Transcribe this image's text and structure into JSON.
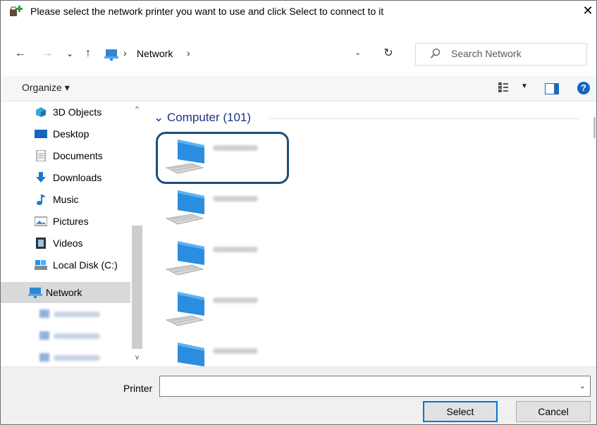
{
  "window": {
    "title": "Please select the network printer you want to use and click Select to connect to it",
    "close_glyph": "✕"
  },
  "nav": {
    "back_glyph": "←",
    "forward_glyph": "→",
    "recent_glyph": "⌄",
    "up_glyph": "↑",
    "address": {
      "sep1": "›",
      "location": "Network",
      "sep2": "›",
      "dropdown_glyph": "⌄"
    },
    "refresh_glyph": "↻",
    "search_placeholder": "Search Network"
  },
  "toolbar": {
    "organize_label": "Organize ▾",
    "view_drop_glyph": "▼",
    "help_glyph": "?"
  },
  "sidebar": {
    "items": [
      {
        "label": "3D Objects",
        "icon": "3d-objects-icon"
      },
      {
        "label": "Desktop",
        "icon": "desktop-icon"
      },
      {
        "label": "Documents",
        "icon": "documents-icon"
      },
      {
        "label": "Downloads",
        "icon": "downloads-icon"
      },
      {
        "label": "Music",
        "icon": "music-icon"
      },
      {
        "label": "Pictures",
        "icon": "pictures-icon"
      },
      {
        "label": "Videos",
        "icon": "videos-icon"
      },
      {
        "label": "Local Disk (C:)",
        "icon": "disk-icon"
      },
      {
        "label": "Network",
        "icon": "network-icon",
        "selected": true
      }
    ],
    "scroll_up_glyph": "^",
    "scroll_down_glyph": "v"
  },
  "main": {
    "group_header": "Computer (101)",
    "group_chevron": "⌄"
  },
  "bottom": {
    "printer_label": "Printer",
    "printer_value": "",
    "dropdown_glyph": "⌄",
    "select_label": "Select",
    "cancel_label": "Cancel"
  },
  "colors": {
    "accent": "#0078d7",
    "highlight_border": "#1e4d78",
    "group_header": "#1e3287",
    "selected_bg": "#d9d9d9"
  }
}
